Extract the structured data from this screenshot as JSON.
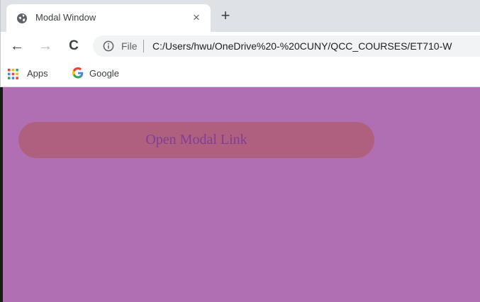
{
  "tab": {
    "title": "Modal Window",
    "close_glyph": "×",
    "favicon": "globe-icon"
  },
  "new_tab_glyph": "+",
  "toolbar": {
    "back_glyph": "←",
    "forward_glyph": "→",
    "reload_glyph": "C",
    "file_label": "File",
    "url": "C:/Users/hwu/OneDrive%20-%20CUNY/QCC_COURSES/ET710-W"
  },
  "bookmarks": [
    {
      "label": "Apps",
      "icon": "apps-grid-icon"
    },
    {
      "label": "Google",
      "icon": "google-icon"
    }
  ],
  "page": {
    "background": "#af6fb2",
    "button_color": "#b0607f",
    "button_text_color": "#7f3d9c",
    "button_label": "Open Modal Link"
  }
}
